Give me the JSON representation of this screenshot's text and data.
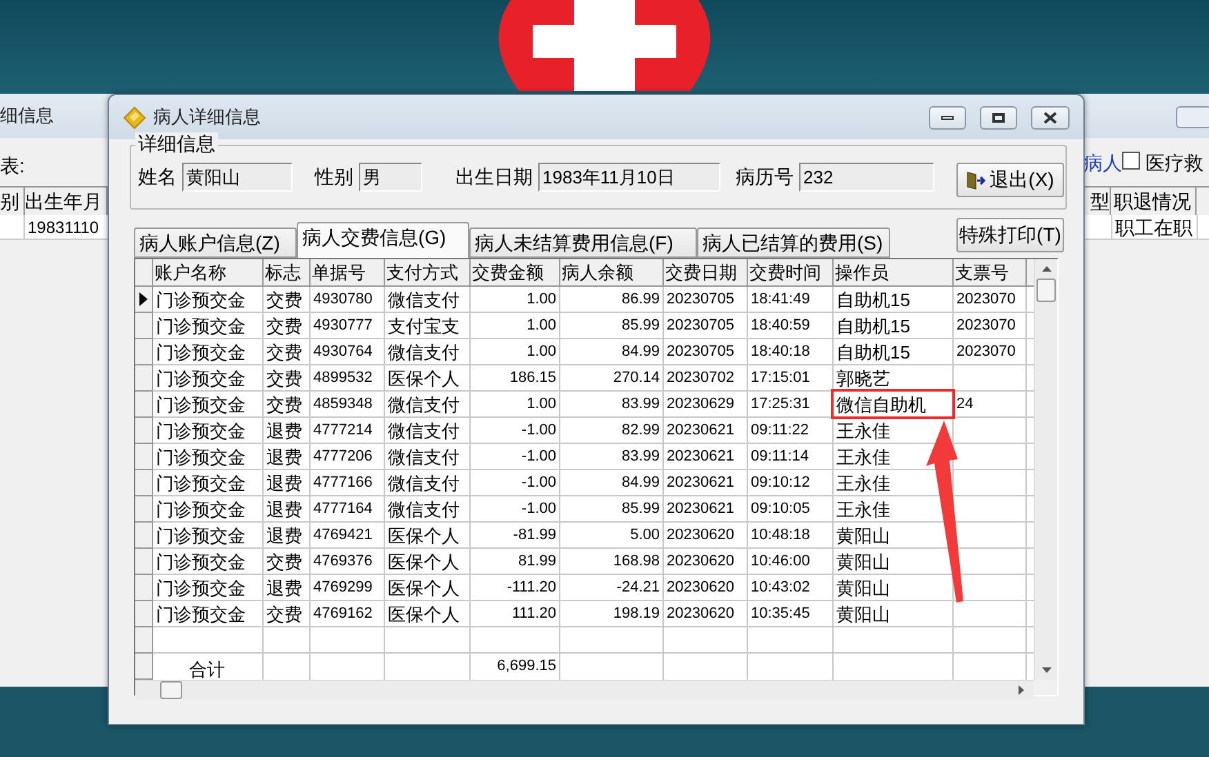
{
  "background_window": {
    "title": "细信息",
    "label": "表:",
    "left_columns": [
      "别",
      "出生年月"
    ],
    "left_cell": "19831110",
    "link": "病人",
    "checkbox": {
      "label": "医疗救",
      "checked": false
    },
    "right_columns": [
      "型",
      "职退情况"
    ],
    "right_cell": "职工在职"
  },
  "dialog": {
    "title": "病人详细信息",
    "group_title": "详细信息",
    "fields": [
      {
        "label": "姓名",
        "value": "黄阳山"
      },
      {
        "label": "性别",
        "value": "男"
      },
      {
        "label": "出生日期",
        "value": "1983年11月10日"
      },
      {
        "label": "病历号",
        "value": "232"
      }
    ],
    "exit_button": "退出(X)",
    "tabs": [
      {
        "label": "病人账户信息(Z)",
        "selected": false
      },
      {
        "label": "病人交费信息(G)",
        "selected": true
      },
      {
        "label": "病人未结算费用信息(F)",
        "selected": false
      },
      {
        "label": "病人已结算的费用(S)",
        "selected": false
      }
    ],
    "print_button": "特殊打印(T)",
    "table": {
      "columns": [
        "账户名称",
        "标志",
        "单据号",
        "支付方式",
        "交费金额",
        "病人余额",
        "交费日期",
        "交费时间",
        "操作员",
        "支票号"
      ],
      "rows": [
        {
          "selected": true,
          "cells": [
            "门诊预交金",
            "交费",
            "4930780",
            "微信支付",
            "1.00",
            "86.99",
            "20230705",
            "18:41:49",
            "自助机15",
            "2023070"
          ]
        },
        {
          "selected": false,
          "cells": [
            "门诊预交金",
            "交费",
            "4930777",
            "支付宝支",
            "1.00",
            "85.99",
            "20230705",
            "18:40:59",
            "自助机15",
            "2023070"
          ]
        },
        {
          "selected": false,
          "cells": [
            "门诊预交金",
            "交费",
            "4930764",
            "微信支付",
            "1.00",
            "84.99",
            "20230705",
            "18:40:18",
            "自助机15",
            "2023070"
          ]
        },
        {
          "selected": false,
          "cells": [
            "门诊预交金",
            "交费",
            "4899532",
            "医保个人",
            "186.15",
            "270.14",
            "20230702",
            "17:15:01",
            "郭晓艺",
            ""
          ]
        },
        {
          "selected": false,
          "cells": [
            "门诊预交金",
            "交费",
            "4859348",
            "微信支付",
            "1.00",
            "83.99",
            "20230629",
            "17:25:31",
            "微信自助机",
            "24"
          ]
        },
        {
          "selected": false,
          "cells": [
            "门诊预交金",
            "退费",
            "4777214",
            "微信支付",
            "-1.00",
            "82.99",
            "20230621",
            "09:11:22",
            "王永佳",
            ""
          ]
        },
        {
          "selected": false,
          "cells": [
            "门诊预交金",
            "退费",
            "4777206",
            "微信支付",
            "-1.00",
            "83.99",
            "20230621",
            "09:11:14",
            "王永佳",
            ""
          ]
        },
        {
          "selected": false,
          "cells": [
            "门诊预交金",
            "退费",
            "4777166",
            "微信支付",
            "-1.00",
            "84.99",
            "20230621",
            "09:10:12",
            "王永佳",
            ""
          ]
        },
        {
          "selected": false,
          "cells": [
            "门诊预交金",
            "退费",
            "4777164",
            "微信支付",
            "-1.00",
            "85.99",
            "20230621",
            "09:10:05",
            "王永佳",
            ""
          ]
        },
        {
          "selected": false,
          "cells": [
            "门诊预交金",
            "退费",
            "4769421",
            "医保个人",
            "-81.99",
            "5.00",
            "20230620",
            "10:48:18",
            "黄阳山",
            ""
          ]
        },
        {
          "selected": false,
          "cells": [
            "门诊预交金",
            "交费",
            "4769376",
            "医保个人",
            "81.99",
            "168.98",
            "20230620",
            "10:46:00",
            "黄阳山",
            ""
          ]
        },
        {
          "selected": false,
          "cells": [
            "门诊预交金",
            "退费",
            "4769299",
            "医保个人",
            "-111.20",
            "-24.21",
            "20230620",
            "10:43:02",
            "黄阳山",
            ""
          ]
        },
        {
          "selected": false,
          "cells": [
            "门诊预交金",
            "交费",
            "4769162",
            "医保个人",
            "111.20",
            "198.19",
            "20230620",
            "10:35:45",
            "黄阳山",
            ""
          ]
        }
      ],
      "total": {
        "label": "合计",
        "amount": "6,699.15"
      }
    }
  }
}
